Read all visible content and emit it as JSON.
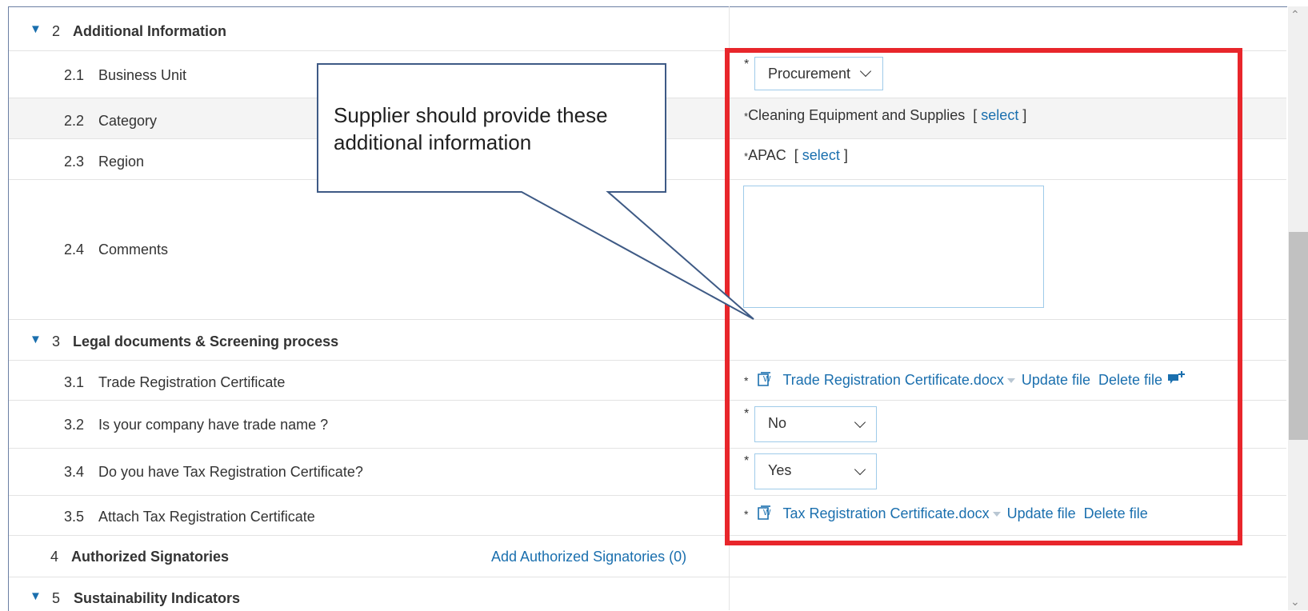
{
  "sections": {
    "s2": {
      "number": "2",
      "title": "Additional Information"
    },
    "s3": {
      "number": "3",
      "title": "Legal documents & Screening process"
    },
    "s4": {
      "number": "4",
      "title": "Authorized Signatories",
      "action": "Add Authorized Signatories (0)"
    },
    "s5": {
      "number": "5",
      "title": "Sustainability Indicators"
    }
  },
  "questions": {
    "q21": {
      "number": "2.1",
      "label": "Business Unit",
      "value": "Procurement"
    },
    "q22": {
      "number": "2.2",
      "label": "Category",
      "value": "Cleaning Equipment and Supplies",
      "select": "select"
    },
    "q23": {
      "number": "2.3",
      "label": "Region",
      "value": "APAC",
      "select": "select"
    },
    "q24": {
      "number": "2.4",
      "label": "Comments",
      "value": ""
    },
    "q31": {
      "number": "3.1",
      "label": "Trade Registration Certificate",
      "file": "Trade Registration Certificate.docx",
      "update": "Update file",
      "delete": "Delete file"
    },
    "q32": {
      "number": "3.2",
      "label": "Is your company have trade name ?",
      "value": "No"
    },
    "q34": {
      "number": "3.4",
      "label": "Do you have Tax Registration Certificate?",
      "value": "Yes"
    },
    "q35": {
      "number": "3.5",
      "label": "Attach Tax Registration Certificate",
      "file": "Tax Registration Certificate.docx",
      "update": "Update file",
      "delete": "Delete file"
    }
  },
  "brackets": {
    "open": "[",
    "close": "]"
  },
  "required_mark": "*",
  "callout": {
    "line1": "Supplier should provide these",
    "line2": "additional information"
  },
  "colors": {
    "link": "#1a6fae",
    "highlight_border": "#e8262b",
    "callout_border": "#3e5a85"
  },
  "icons": [
    "expand-triangle-icon",
    "word-document-icon",
    "dropdown-arrow-icon",
    "add-comment-icon",
    "chevron-down-icon"
  ]
}
